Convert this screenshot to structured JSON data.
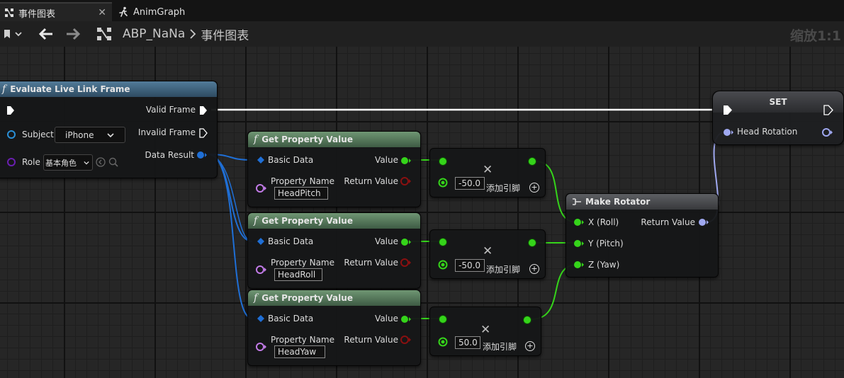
{
  "tabs": [
    {
      "label": "事件图表",
      "icon": "graph-icon",
      "active": true
    },
    {
      "label": "AnimGraph",
      "icon": "running-man-icon",
      "active": false
    }
  ],
  "toolbar": {
    "breadcrumb": [
      "ABP_NaNa",
      "事件图表"
    ],
    "zoom": "缩放1:1"
  },
  "nodes": {
    "live_link": {
      "title": "Evaluate Live Link Frame",
      "valid_frame": "Valid Frame",
      "subject_label": "Subject",
      "subject_value": "iPhone",
      "invalid_frame": "Invalid Frame",
      "role_label": "Role",
      "role_value": "基本角色",
      "data_result": "Data Result"
    },
    "get_prop": [
      {
        "title": "Get Property Value",
        "basic_data": "Basic Data",
        "value": "Value",
        "property_name": "Property Name",
        "return_value": "Return Value",
        "name_value": "HeadPitch"
      },
      {
        "title": "Get Property Value",
        "basic_data": "Basic Data",
        "value": "Value",
        "property_name": "Property Name",
        "return_value": "Return Value",
        "name_value": "HeadRoll"
      },
      {
        "title": "Get Property Value",
        "basic_data": "Basic Data",
        "value": "Value",
        "property_name": "Property Name",
        "return_value": "Return Value",
        "name_value": "HeadYaw"
      }
    ],
    "multiply": [
      {
        "constant": "-50.0",
        "add_pin": "添加引脚"
      },
      {
        "constant": "-50.0",
        "add_pin": "添加引脚"
      },
      {
        "constant": "50.0",
        "add_pin": "添加引脚"
      }
    ],
    "make_rotator": {
      "title": "Make Rotator",
      "x": "X (Roll)",
      "y": "Y (Pitch)",
      "z": "Z (Yaw)",
      "return_value": "Return Value"
    },
    "set": {
      "title": "SET",
      "head_rotation": "Head Rotation"
    }
  },
  "colors": {
    "exec": "#ffffff",
    "float": "#35d41a",
    "struct": "#1f6fd6",
    "name": "#c27be8",
    "rotator": "#9fa8f0",
    "bool": "#8a1010"
  }
}
